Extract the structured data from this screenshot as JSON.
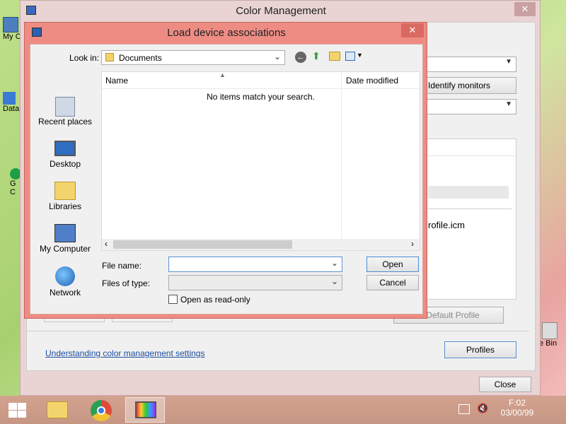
{
  "desktop": {
    "icon_labels": [
      "My C",
      "Data",
      "G",
      "C",
      "e Bin"
    ]
  },
  "color_mgmt": {
    "title": "Color Management",
    "identify_monitors": "Identify monitors",
    "profile_file": "rofile.icm",
    "set_default_profile": "s Default Profile",
    "understanding_link": "Understanding color management settings",
    "profiles_button": "Profiles",
    "close_button": "Close"
  },
  "dialog": {
    "title": "Load device associations",
    "look_in_label": "Look in:",
    "look_in_value": "Documents",
    "places": [
      {
        "label": "Recent places",
        "icon": "recent-places-icon"
      },
      {
        "label": "Desktop",
        "icon": "desktop-icon"
      },
      {
        "label": "Libraries",
        "icon": "libraries-icon"
      },
      {
        "label": "My Computer",
        "icon": "my-computer-icon"
      },
      {
        "label": "Network",
        "icon": "network-icon"
      }
    ],
    "columns": {
      "name": "Name",
      "date_modified": "Date modified"
    },
    "empty_message": "No items match your search.",
    "file_name_label": "File name:",
    "file_name_value": "",
    "files_of_type_label": "Files of type:",
    "files_of_type_value": "",
    "read_only_label": "Open as read-only",
    "read_only_checked": false,
    "open_button": "Open",
    "cancel_button": "Cancel"
  },
  "taskbar": {
    "time": "F:02",
    "date": "03/00/99",
    "apps": [
      "start-icon",
      "file-explorer-icon",
      "chrome-icon",
      "color-management-icon"
    ]
  },
  "colors": {
    "dialog_frame": "#ee8c84",
    "window_frame": "#e9d3d3",
    "taskbar": "#c69684"
  }
}
